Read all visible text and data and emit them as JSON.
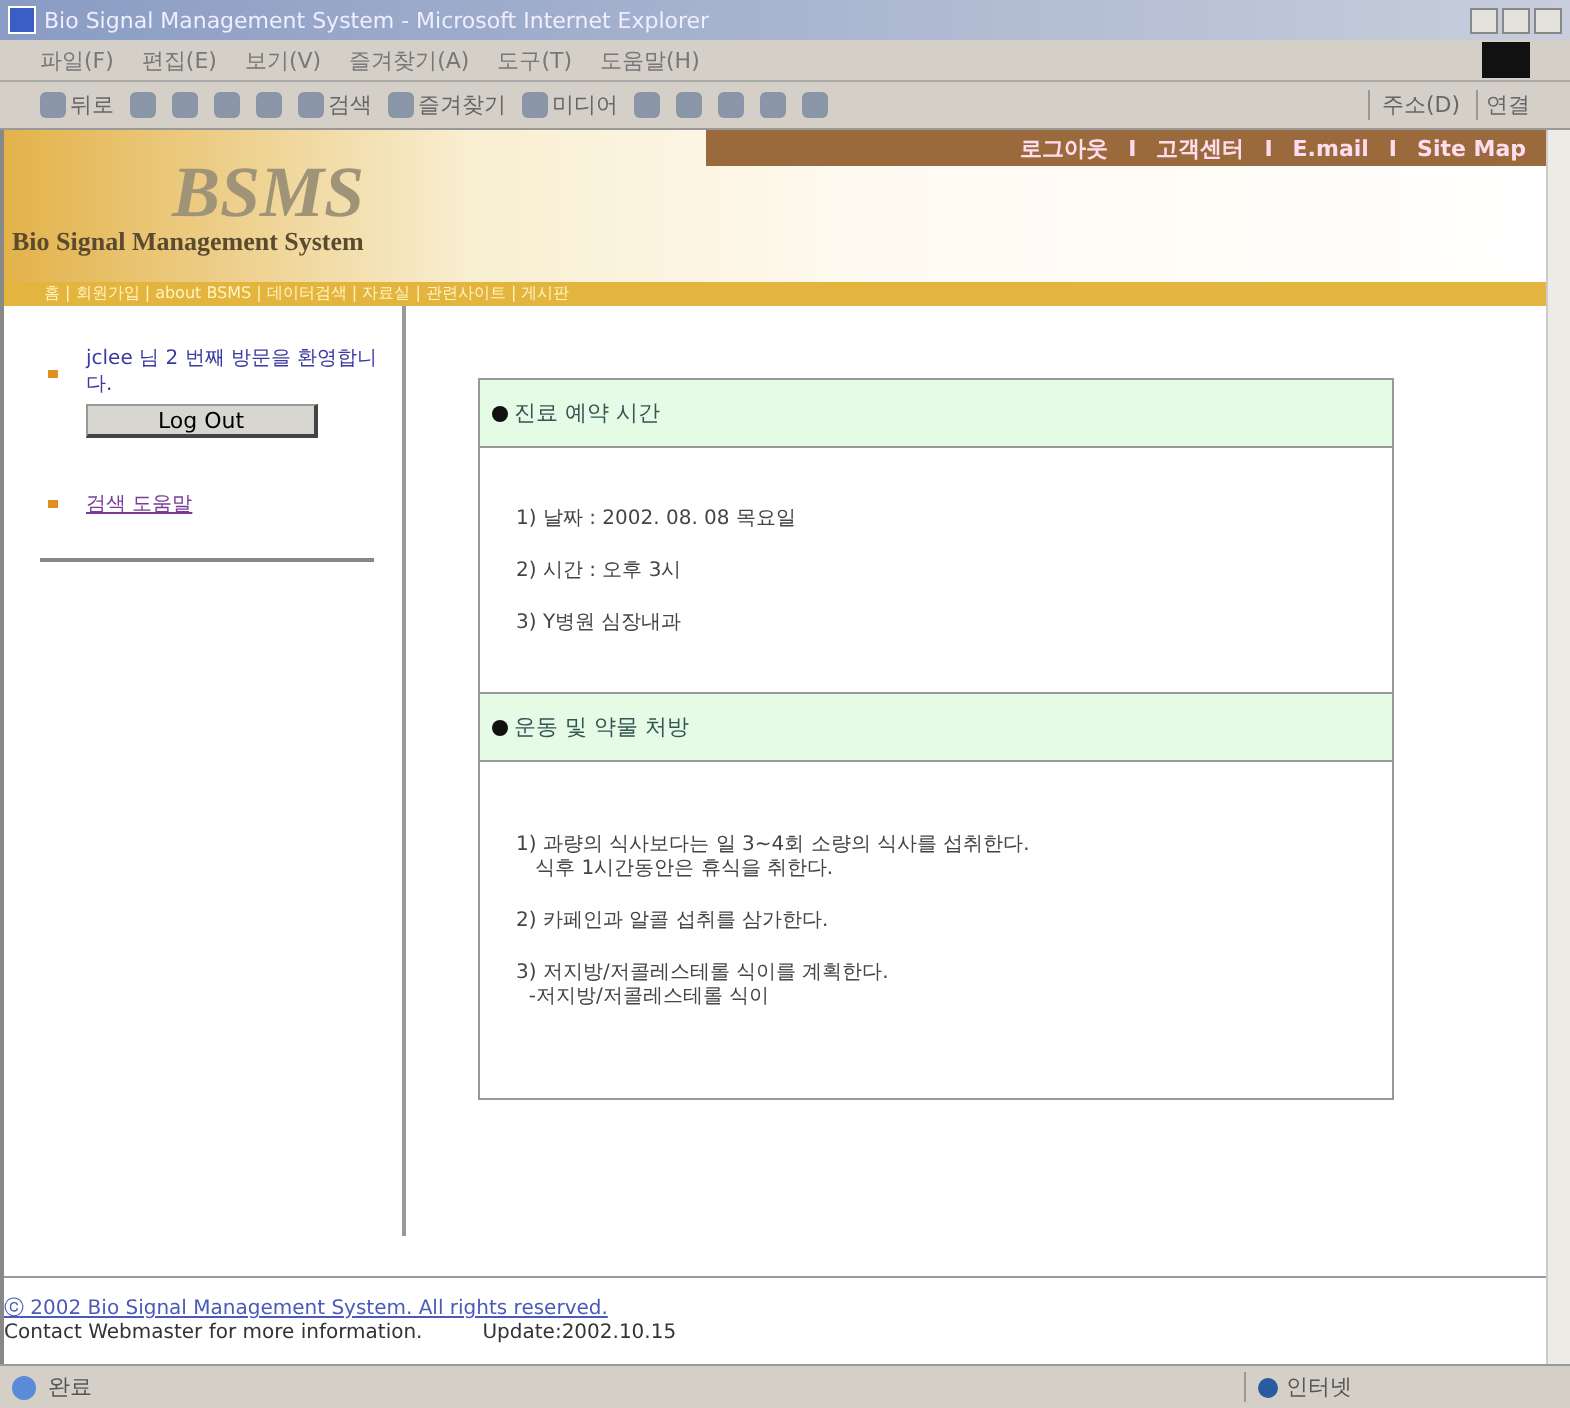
{
  "window": {
    "title": "Bio Signal Management System - Microsoft Internet Explorer"
  },
  "menu": [
    "파일(F)",
    "편집(E)",
    "보기(V)",
    "즐겨찾기(A)",
    "도구(T)",
    "도움말(H)"
  ],
  "toolbar": {
    "buttons": [
      "뒤로",
      "검색",
      "즐겨찾기",
      "미디어"
    ],
    "address_label": "주소(D)",
    "links_label": "연결"
  },
  "header": {
    "top_links": [
      "로그아웃",
      "I",
      "고객센터",
      "I",
      "E.mail",
      "I",
      "Site Map"
    ],
    "logo": "BSMS",
    "subtitle": "Bio Signal Management System",
    "nav": "홈 | 회원가입 | about BSMS | 데이터검색 | 자료실 | 관련사이트 | 게시판"
  },
  "sidebar": {
    "welcome": "jclee 님 2 번째 방문을 환영합니다.",
    "logout_button": "Log Out",
    "link": "검색 도움말"
  },
  "sections": [
    {
      "title": "진료 예약 시간",
      "lines": [
        "1) 날짜 : 2002. 08. 08 목요일",
        "2) 시간 : 오후 3시",
        "3) Y병원 심장내과"
      ]
    },
    {
      "title": "운동 및 약물 처방",
      "lines": [
        "1) 과량의 식사보다는 일 3~4회 소량의 식사를 섭취한다.\n   식후 1시간동안은 휴식을 취한다.",
        "2) 카페인과 알콜 섭취를 삼가한다.",
        "3) 저지방/저콜레스테롤 식이를 계획한다.\n  -저지방/저콜레스테롤 식이"
      ]
    }
  ],
  "footer": {
    "copyright": "ⓒ 2002 Bio Signal Management System. All rights reserved.",
    "contact": "Contact Webmaster for more information.",
    "update": "Update:2002.10.15"
  },
  "status_bar": {
    "text": "완료",
    "zone": "인터넷"
  }
}
